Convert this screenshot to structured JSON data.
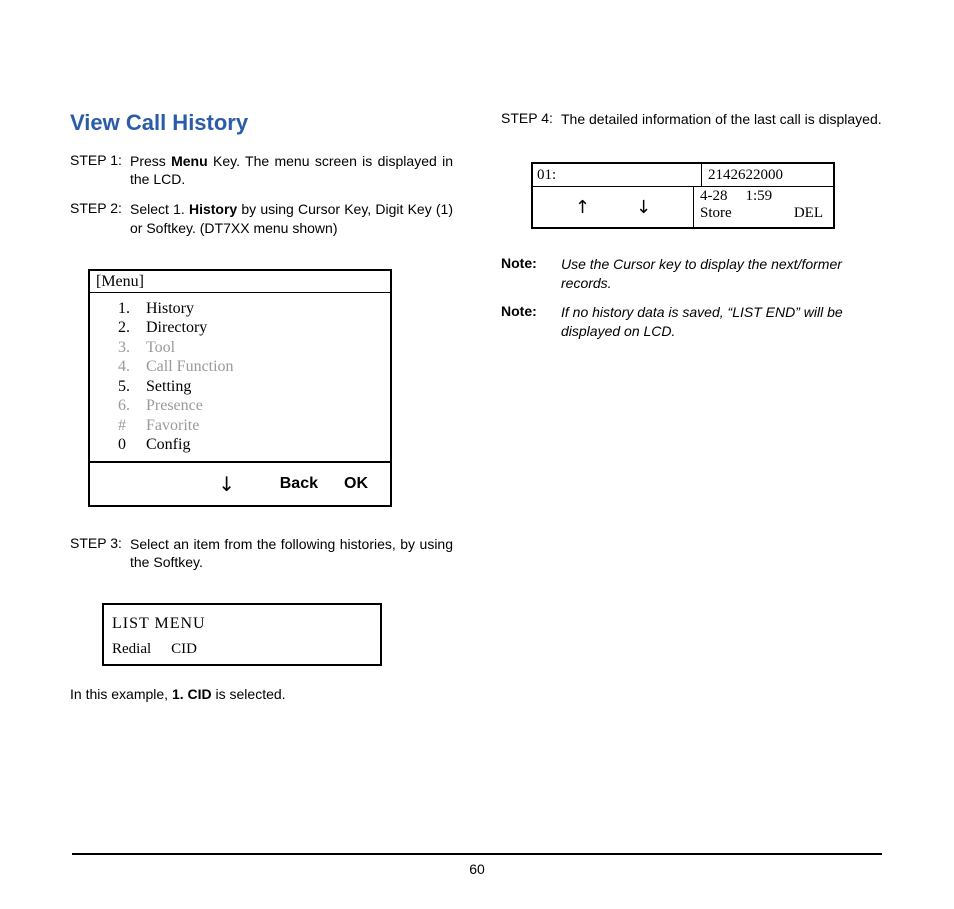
{
  "heading": "View Call History",
  "steps": {
    "s1": {
      "label": "STEP 1:",
      "pre": " Press ",
      "bold": "Menu",
      "post": " Key. The menu screen is displayed in the LCD."
    },
    "s2": {
      "label": "STEP 2:",
      "pre": " Select 1. ",
      "bold": "History",
      "post": " by using Cursor Key, Digit Key (1) or Softkey. (DT7XX menu shown)"
    },
    "s3": {
      "label": "STEP 3:",
      "text": " Select an item from the following histories, by using the Softkey."
    },
    "s4": {
      "label": "STEP 4:",
      "text": " The detailed information of the last call is displayed."
    }
  },
  "menu": {
    "title": "[Menu]",
    "items": {
      "i0": {
        "idx": "1.",
        "txt": "History",
        "dim": false
      },
      "i1": {
        "idx": "2.",
        "txt": "Directory",
        "dim": false
      },
      "i2": {
        "idx": "3.",
        "txt": "Tool",
        "dim": true
      },
      "i3": {
        "idx": "4.",
        "txt": "Call Function",
        "dim": true
      },
      "i4": {
        "idx": "5.",
        "txt": "Setting",
        "dim": false
      },
      "i5": {
        "idx": "6.",
        "txt": "Presence",
        "dim": true
      },
      "i6": {
        "idx": "#",
        "txt": "Favorite",
        "dim": true
      },
      "i7": {
        "idx": "0",
        "txt": "Config",
        "dim": false
      }
    },
    "back": "Back",
    "ok": "OK",
    "down": "↓"
  },
  "listmenu": {
    "title": "LIST  MENU",
    "opt1": "Redial",
    "opt2": "CID"
  },
  "example": {
    "pre": "In this example, ",
    "bold": "1. CID",
    "post": " is selected."
  },
  "detail": {
    "idx": "01:",
    "number": "2142622000",
    "date": "4-28",
    "time": "1:59",
    "soft1": "Store",
    "soft2": "DEL",
    "up": "↑",
    "down": "↓"
  },
  "notes": {
    "n1": {
      "label": "Note:",
      "text": "Use the Cursor key to display the next/former records."
    },
    "n2": {
      "label": "Note:",
      "text": "If no history data is saved, “LIST END” will be displayed on LCD."
    }
  },
  "page": "60"
}
